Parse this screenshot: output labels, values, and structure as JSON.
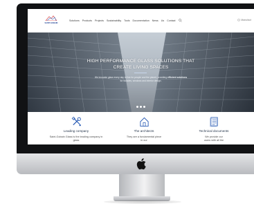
{
  "brand": {
    "name": "SAINT-GOBAIN",
    "color": "#1c3f94"
  },
  "nav": {
    "items": [
      "Solutions",
      "Products",
      "Projects",
      "Sustainability",
      "Tools",
      "Documentation",
      "News",
      "Us",
      "Contact"
    ],
    "search_icon": "search-icon",
    "language": "Manufact"
  },
  "hero": {
    "title_line1": "HIGH PERFORMANCE GLASS SOLUTIONS THAT",
    "title_line2": "CREATE LIVING SPACES",
    "subtitle_part1": "We innovate glass every day to live for people and the planet, providing",
    "subtitle_bold": "efficient solutions",
    "subtitle_line2": "for facades, windows and interior design.",
    "slide_count": 3
  },
  "features": [
    {
      "icon": "tools-icon",
      "title": "Leading company",
      "desc_line1": "Saint-Gobain Glass is the leading company in",
      "desc_line2": "glass"
    },
    {
      "icon": "house-icon",
      "title": "The architects",
      "desc_line1": "They are a fundamental piece",
      "desc_line2": "in our"
    },
    {
      "icon": "document-icon",
      "title": "Technical documents",
      "desc_line1": "We provide our",
      "desc_line2": "users with all the"
    }
  ],
  "device": {
    "logo_icon": "apple-logo-icon"
  },
  "colors": {
    "accent": "#1c3f94",
    "bezel": "#111214",
    "hero_dark": "#39414b"
  }
}
